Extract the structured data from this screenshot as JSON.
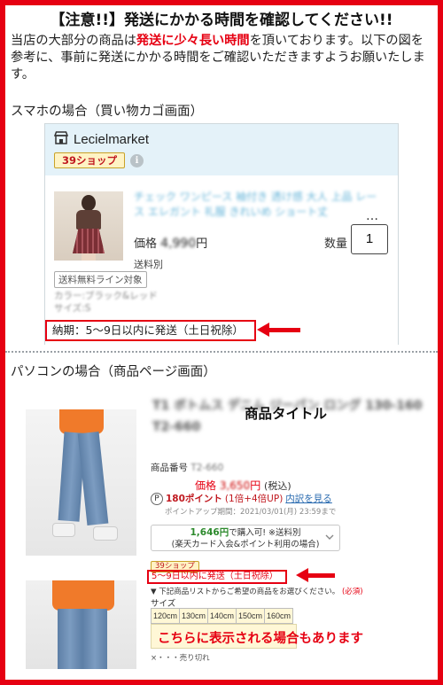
{
  "headline": "【注意!!】発送にかかる時間を確認してください!!",
  "intro": {
    "part1": "当店の大部分の商品は",
    "highlight": "発送に少々長い時間",
    "part2": "を頂いております。以下の図を参考に、事前に発送にかかる時間をご確認いただきますようお願いたします。"
  },
  "smartphone_section": {
    "title": "スマホの場合（買い物カゴ画面）",
    "store_name": "Lecielmarket",
    "shop_badge": "39ショップ",
    "info_icon": "i",
    "product_title": "チェック ワンピース 袖付き 透け感 大人 上品 レース エレガント 礼服 きれいめ ショート丈",
    "ellipsis": "…",
    "price_label": "価格",
    "price_value": "4,990",
    "price_unit": "円",
    "quantity_label": "数量",
    "quantity_value": "1",
    "shipping_text": "送料別",
    "free_shipping_tag": "送料無料ライン対象",
    "variant_lines": [
      "カラー:ブラック&レッド",
      "サイズ:S"
    ],
    "delivery_text": "納期：5〜9日以内に発送（土日祝除）"
  },
  "pc_section": {
    "title": "パソコンの場合（商品ページ画面）",
    "blurred_title": "T1 ボトムス デニム ジーパン ロング 130-160 T2-660",
    "product_title_label": "商品タイトル",
    "sku_label": "商品番号",
    "sku_value": "T2-660",
    "price_label": "価格",
    "price_value": "3,650",
    "price_unit": "円",
    "tax_label": "(税込)",
    "points_icon": "P",
    "points_text": "180ポイント",
    "points_detail": "(1倍+4倍UP)",
    "points_link": "内訳を見る",
    "points_date": "ポイントアップ期間：2021/03/01(月) 23:59まで",
    "ship_line1_amount": "1,646円",
    "ship_line1_rest": "で購入可! ※送料別",
    "ship_line2": "(楽天カード入会&ポイント利用の場合)",
    "shop_badge": "39ショップ",
    "delivery_text": "5〜9日以内に発送（土日祝除）",
    "note_text": "▼ 下記商品リストからご希望の商品をお選びください。",
    "note_required": "(必須)",
    "size_label": "サイズ",
    "sizes": [
      "120cm",
      "130cm",
      "140cm",
      "150cm",
      "160cm"
    ],
    "sold_out_note": "×・・・売り切れ",
    "callout": "こちらに表示される場合もあります"
  },
  "colors": {
    "accent_red": "#e60012",
    "header_blue": "#e4f2f9",
    "badge_yellow": "#fff3c4"
  }
}
